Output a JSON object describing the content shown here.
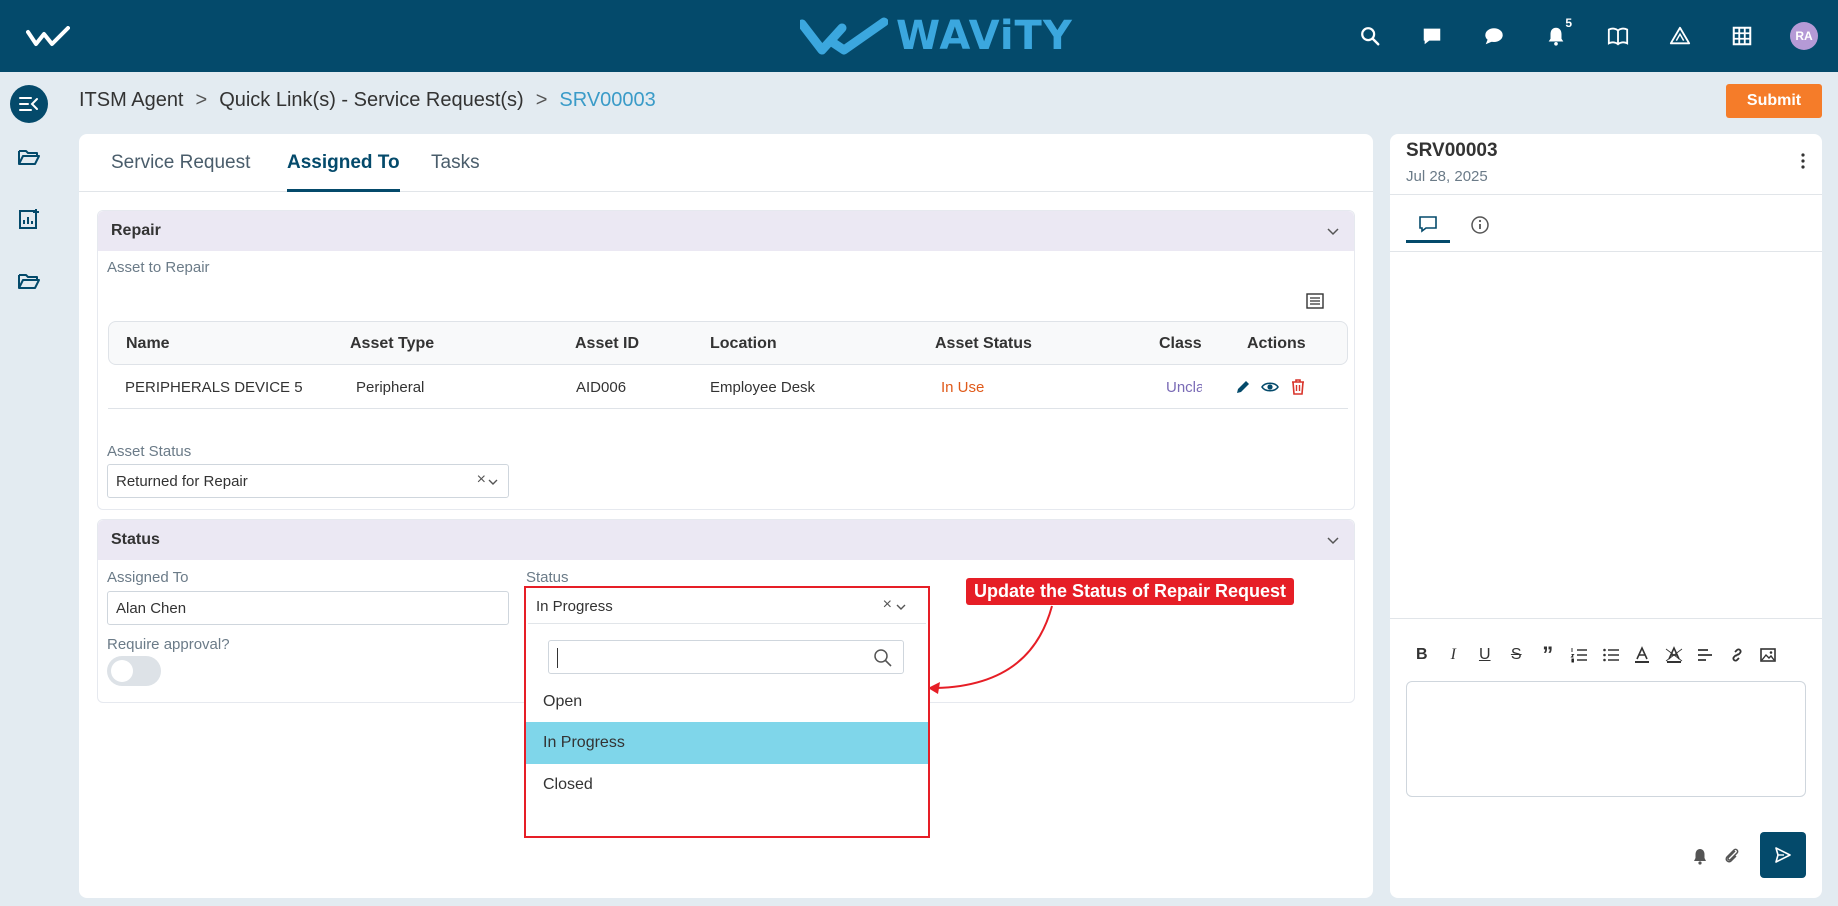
{
  "app": {
    "brand": "WAViTY",
    "notification_count": "5",
    "avatar_initials": "RA",
    "colors": {
      "topbar": "#044a6b",
      "accent": "#3ba7de",
      "submit": "#f57c29",
      "callout": "#e61e26",
      "selected": "#7fd6ea"
    }
  },
  "topbar": {
    "icons": [
      "search-icon",
      "chat-square-icon",
      "chat-bubble-icon",
      "bell-icon",
      "book-icon",
      "alert-triangle-icon",
      "grid-icon"
    ]
  },
  "breadcrumb": {
    "items": [
      "ITSM Agent",
      "Quick Link(s) - Service Request(s)"
    ],
    "separator": ">",
    "current": "SRV00003"
  },
  "actions": {
    "submit_label": "Submit"
  },
  "tabs": [
    "Service Request",
    "Assigned To",
    "Tasks"
  ],
  "repair": {
    "title": "Repair",
    "asset_label": "Asset to Repair",
    "columns": [
      "Name",
      "Asset Type",
      "Asset ID",
      "Location",
      "Asset Status",
      "Class",
      "Actions"
    ],
    "rows": [
      {
        "name": "PERIPHERALS DEVICE 5",
        "type": "Peripheral",
        "id": "AID006",
        "location": "Employee Desk",
        "status": "In Use",
        "class": "Unclassified"
      }
    ],
    "asset_status_label": "Asset Status",
    "asset_status_value": "Returned for Repair"
  },
  "status_section": {
    "title": "Status",
    "assigned_label": "Assigned To",
    "assigned_value": "Alan Chen",
    "approval_label": "Require approval?",
    "status_label": "Status",
    "status_value": "In Progress",
    "options": [
      "Open",
      "In Progress",
      "Closed"
    ],
    "selected_option": "In Progress"
  },
  "callout": {
    "text": "Update the Status of Repair Request"
  },
  "side_panel": {
    "id": "SRV00003",
    "date": "Jul 28, 2025",
    "editor_tools": [
      "B",
      "I",
      "U",
      "S",
      "”"
    ]
  }
}
